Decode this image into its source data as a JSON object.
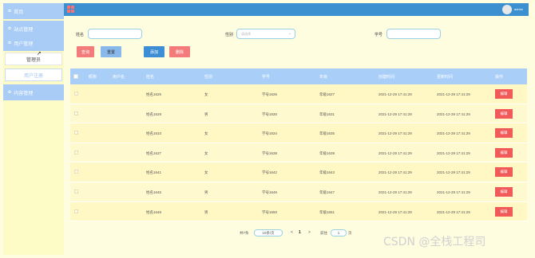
{
  "sidebar": {
    "items": [
      {
        "label": "首页",
        "icon": "home-icon"
      },
      {
        "label": "站点管理",
        "icon": "site-icon"
      },
      {
        "label": "用户管理",
        "icon": "user-icon"
      },
      {
        "label": "内容管理",
        "icon": "content-icon"
      }
    ],
    "subitems": [
      {
        "label": "管理员"
      },
      {
        "label": "用户注册"
      }
    ]
  },
  "header": {
    "username": "admin"
  },
  "search": {
    "name_label": "姓名",
    "name_value": "",
    "gender_label": "性别",
    "gender_placeholder": "请选择",
    "student_id_label": "学号",
    "student_id_value": ""
  },
  "actions": {
    "query": "查询",
    "reset": "重置",
    "add": "添加",
    "delete": "删除"
  },
  "table": {
    "headers": [
      "昵称",
      "用户名",
      "姓名",
      "性别",
      "学号",
      "年级",
      "创建时间",
      "更新时间",
      "操作"
    ],
    "rows": [
      {
        "name": "姓名1625",
        "gender": "女",
        "sid": "学号1626",
        "grade": "年级1627",
        "created": "2021-12-29 17:41:29",
        "updated": "2021-12-29 17:41:29"
      },
      {
        "name": "姓名1629",
        "gender": "男",
        "sid": "学号1630",
        "grade": "年级1631",
        "created": "2021-12-29 17:41:29",
        "updated": "2021-12-29 17:41:29"
      },
      {
        "name": "姓名1633",
        "gender": "女",
        "sid": "学号1634",
        "grade": "年级1635",
        "created": "2021-12-29 17:41:29",
        "updated": "2021-12-29 17:41:29"
      },
      {
        "name": "姓名1637",
        "gender": "女",
        "sid": "学号1638",
        "grade": "年级1639",
        "created": "2021-12-29 17:41:29",
        "updated": "2021-12-29 17:41:29"
      },
      {
        "name": "姓名1641",
        "gender": "女",
        "sid": "学号1642",
        "grade": "年级1643",
        "created": "2021-12-29 17:41:29",
        "updated": "2021-12-29 17:41:29"
      },
      {
        "name": "姓名1645",
        "gender": "男",
        "sid": "学号1646",
        "grade": "年级1647",
        "created": "2021-12-29 17:41:29",
        "updated": "2021-12-29 17:41:29"
      },
      {
        "name": "姓名1649",
        "gender": "男",
        "sid": "学号1650",
        "grade": "年级1651",
        "created": "2021-12-29 17:41:29",
        "updated": "2021-12-29 17:41:29"
      }
    ],
    "edit_label": "编辑"
  },
  "pagination": {
    "total_label": "共7条",
    "page_size": "10条/页",
    "prev": "<",
    "page": "1",
    "next": ">",
    "goto_label": "前往",
    "goto_value": "1",
    "goto_suffix": "页"
  },
  "watermark": "CSDN @全栈工程司",
  "colors": {
    "topbar": "#3d90cf",
    "sidebar_item": "#a8ccf6",
    "table_header": "#a9cff8",
    "row_bg": "#fff9cf",
    "danger": "#f25a5a"
  }
}
